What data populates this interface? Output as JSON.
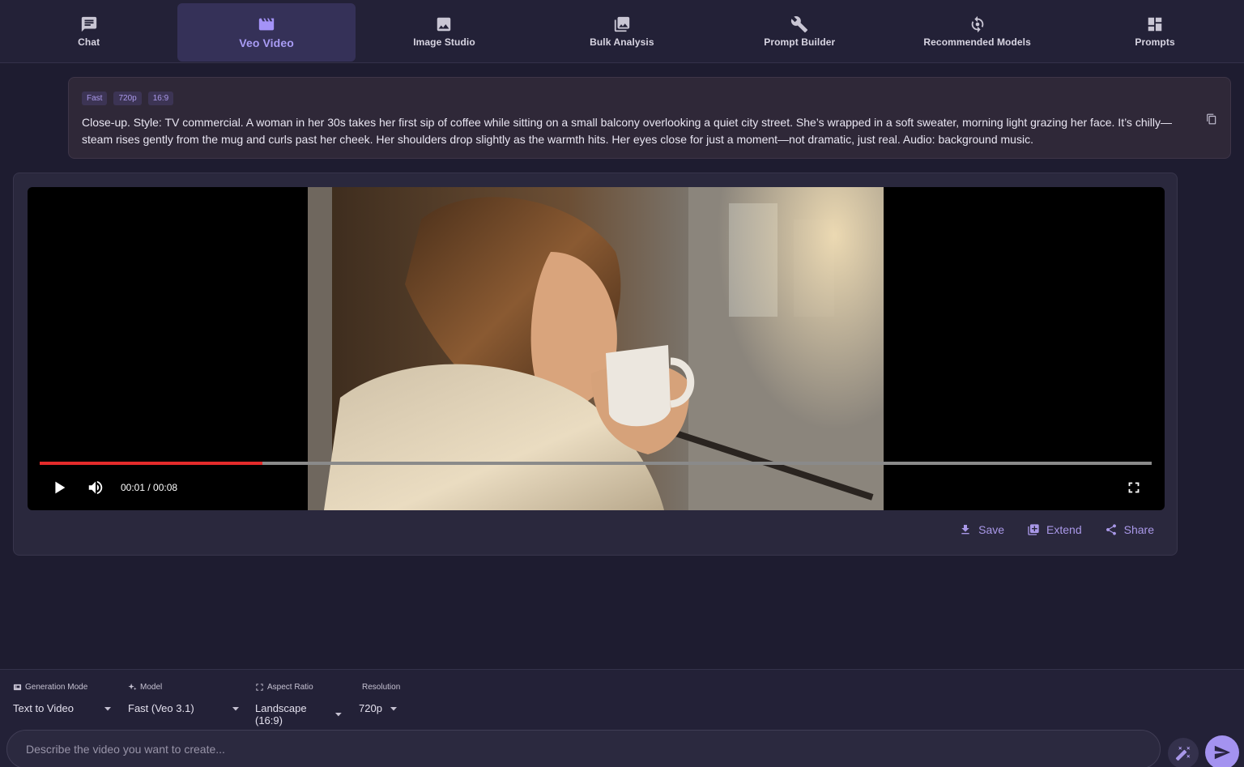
{
  "nav": {
    "tabs": [
      {
        "label": "Chat",
        "icon": "chat-icon"
      },
      {
        "label": "Veo Video",
        "icon": "movie-icon",
        "active": true
      },
      {
        "label": "Image Studio",
        "icon": "image-icon"
      },
      {
        "label": "Bulk Analysis",
        "icon": "photo-library-icon"
      },
      {
        "label": "Prompt Builder",
        "icon": "wrench-icon"
      },
      {
        "label": "Recommended Models",
        "icon": "model-icon"
      },
      {
        "label": "Prompts",
        "icon": "dashboard-icon"
      }
    ]
  },
  "prompt_card": {
    "chips": [
      "Fast",
      "720p",
      "16:9"
    ],
    "text": "Close-up. Style: TV commercial. A woman in her 30s takes her first sip of coffee while sitting on a small balcony overlooking a quiet city street. She’s wrapped in a soft sweater, morning light grazing her face. It’s chilly—steam rises gently from the mug and curls past her cheek. Her shoulders drop slightly as the warmth hits. Her eyes close for just a moment—not dramatic, just real. Audio: background music."
  },
  "video": {
    "time": "00:01 / 00:08",
    "progress_fraction": 0.2,
    "actions": {
      "save": "Save",
      "extend": "Extend",
      "share": "Share"
    }
  },
  "settings": {
    "generation_mode": {
      "label": "Generation Mode",
      "value": "Text to Video"
    },
    "model": {
      "label": "Model",
      "value": "Fast (Veo 3.1)"
    },
    "aspect_ratio": {
      "label": "Aspect Ratio",
      "value": "Landscape (16:9)"
    },
    "resolution": {
      "label": "Resolution",
      "value": "720p"
    }
  },
  "input": {
    "placeholder": "Describe the video you want to create..."
  },
  "colors": {
    "accent": "#a493f0",
    "background": "#1e1c30",
    "progress": "#e52b2b"
  }
}
